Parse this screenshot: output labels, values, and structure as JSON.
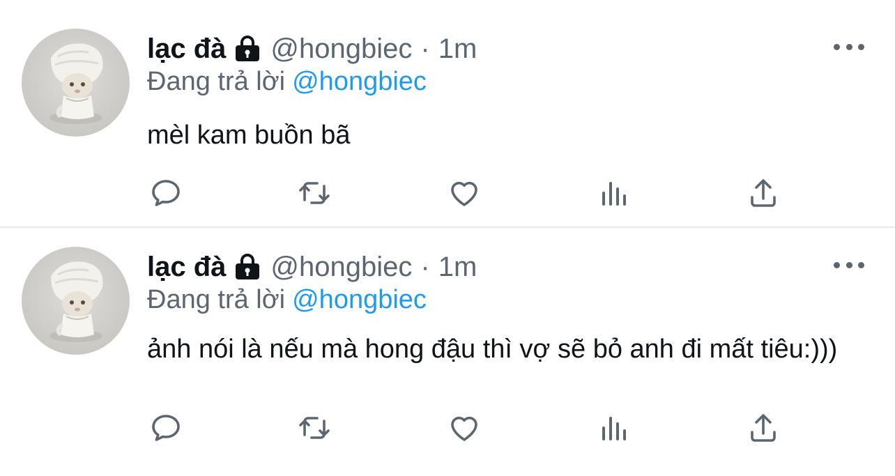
{
  "tweets": [
    {
      "author_name": "lạc đà",
      "author_handle": "@hongbiec",
      "separator": "·",
      "time": "1m",
      "replying_label": "Đang trả lời",
      "replying_to": "@hongbiec",
      "text": "mèl kam buồn bã",
      "icons": [
        "lock-icon",
        "more-icon",
        "reply-icon",
        "retweet-icon",
        "like-icon",
        "analytics-icon",
        "share-icon"
      ]
    },
    {
      "author_name": "lạc đà",
      "author_handle": "@hongbiec",
      "separator": "·",
      "time": "1m",
      "replying_label": "Đang trả lời",
      "replying_to": "@hongbiec",
      "text": "ảnh nói là nếu mà hong đậu thì vợ sẽ bỏ anh đi mất tiêu:)))",
      "icons": [
        "lock-icon",
        "more-icon",
        "reply-icon",
        "retweet-icon",
        "like-icon",
        "analytics-icon",
        "share-icon"
      ]
    }
  ],
  "colors": {
    "text": "#0f1419",
    "secondary": "#5b6670",
    "link": "#1d9bf0",
    "divider": "#e6e9eb"
  }
}
